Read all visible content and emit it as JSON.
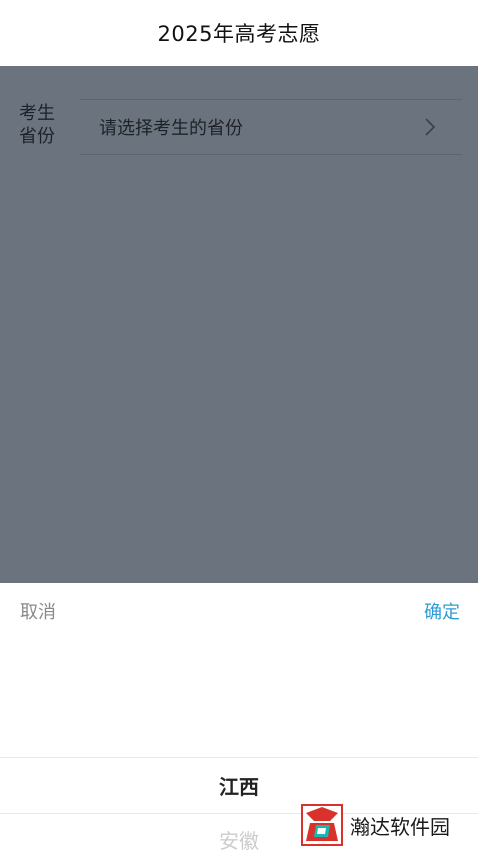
{
  "header": {
    "title": "2025年高考志愿"
  },
  "form": {
    "province_label": "考生\n省份",
    "province_placeholder": "请选择考生的省份",
    "chevron_icon": "chevron-right-icon"
  },
  "picker": {
    "cancel_label": "取消",
    "confirm_label": "确定",
    "selected_option": "江西",
    "next_option": "安徽"
  },
  "watermark": {
    "text": "瀚达软件园"
  },
  "colors": {
    "overlay": "#6b737e",
    "confirm": "#2c9cd6",
    "cancel": "#8a8a8a",
    "watermark_red": "#d9322c",
    "watermark_teal": "#16b8b0"
  }
}
